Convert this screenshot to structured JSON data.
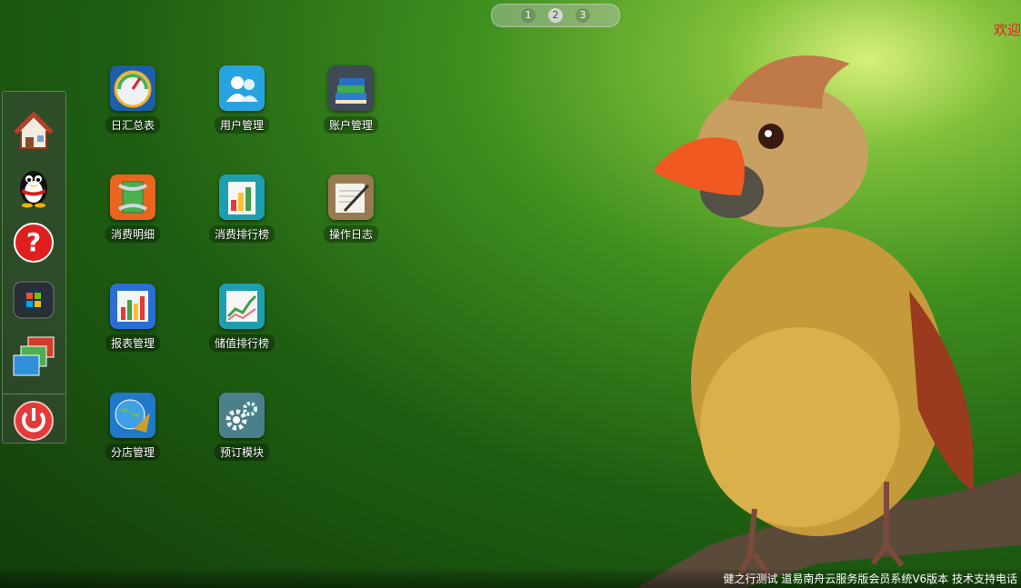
{
  "pager": {
    "pages": [
      "1",
      "2",
      "3"
    ],
    "active_index": 1
  },
  "header": {
    "welcome": "欢迎"
  },
  "dock": {
    "items": [
      {
        "name": "home-icon"
      },
      {
        "name": "qq-penguin-icon"
      },
      {
        "name": "help-icon"
      },
      {
        "name": "windows-icon"
      },
      {
        "name": "windows-stack-icon"
      },
      {
        "name": "power-icon"
      }
    ]
  },
  "apps": [
    {
      "label": "日汇总表",
      "icon": "gauge-icon"
    },
    {
      "label": "用户管理",
      "icon": "users-icon"
    },
    {
      "label": "账户管理",
      "icon": "books-icon"
    },
    {
      "label": "消费明细",
      "icon": "compress-icon"
    },
    {
      "label": "消费排行榜",
      "icon": "bar-chart-icon"
    },
    {
      "label": "操作日志",
      "icon": "notepad-pen-icon"
    },
    {
      "label": "报表管理",
      "icon": "report-bars-icon"
    },
    {
      "label": "储值排行榜",
      "icon": "line-chart-icon"
    },
    {
      "label": "分店管理",
      "icon": "globe-sextant-icon"
    },
    {
      "label": "预订模块",
      "icon": "gears-icon"
    }
  ],
  "footer": {
    "text": "健之行测试 道易南舟云服务版会员系统V6版本 技术支持电话"
  },
  "colors": {
    "welcome": "#e02020"
  }
}
